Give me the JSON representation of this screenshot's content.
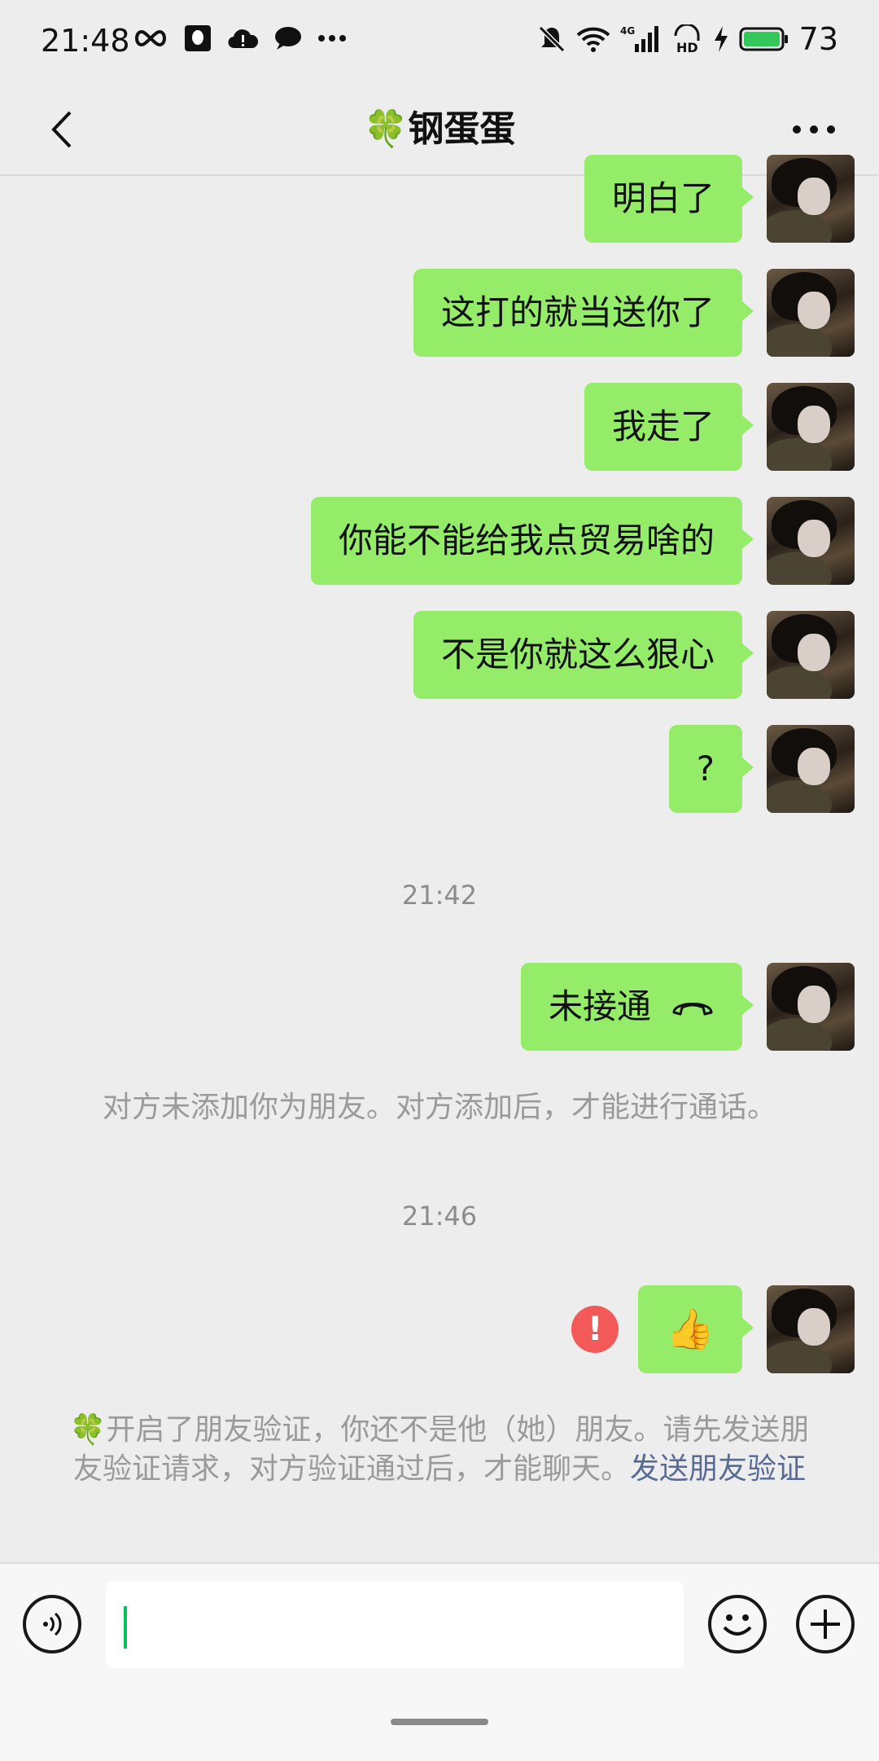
{
  "status_bar": {
    "time": "21:48",
    "battery_level": "73",
    "left_icons": [
      "infinity-icon",
      "qq-icon",
      "alert-cloud-icon",
      "chat-bubble-icon",
      "more-dots-icon"
    ],
    "right_icons": [
      "mute-icon",
      "wifi-icon",
      "4g-signal-icon",
      "hd-icon",
      "charging-icon",
      "battery-icon"
    ]
  },
  "nav": {
    "title": "🍀钢蛋蛋"
  },
  "messages": [
    {
      "text": "明白了"
    },
    {
      "text": "这打的就当送你了"
    },
    {
      "text": "我走了"
    },
    {
      "text": "你能不能给我点贸易啥的"
    },
    {
      "text": "不是你就这么狠心"
    },
    {
      "text": "?"
    }
  ],
  "time_1": "21:42",
  "call_message": {
    "text": "未接通"
  },
  "call_note": "对方未添加你为朋友。对方添加后，才能进行通话。",
  "time_2": "21:46",
  "emoji_message": {
    "text": "👍"
  },
  "verify_note": {
    "text": "🍀开启了朋友验证，你还不是他（她）朋友。请先发送朋友验证请求，对方验证通过后，才能聊天。",
    "link": "发送朋友验证"
  },
  "error_mark": "!",
  "colors": {
    "bubble": "#95ec69",
    "background": "#ededed",
    "link": "#576b95",
    "error": "#f25a5a",
    "caret": "#07c160"
  }
}
